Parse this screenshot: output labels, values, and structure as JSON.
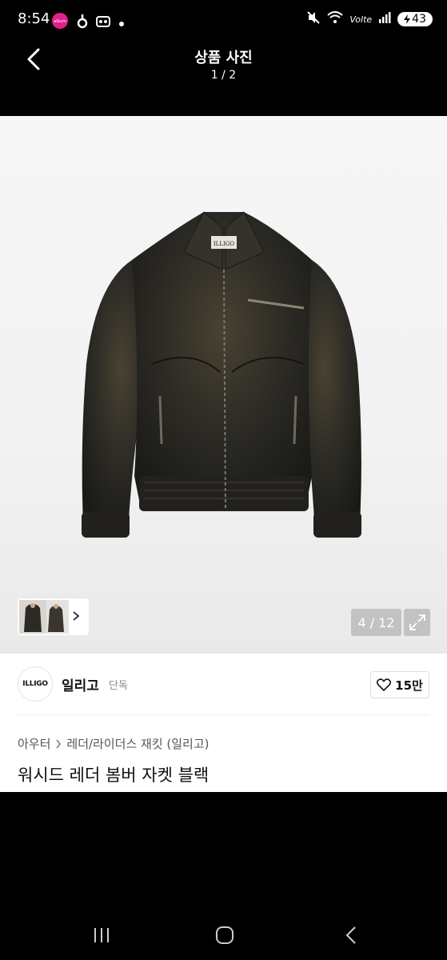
{
  "status_bar": {
    "time": "8:54",
    "lte_label": "Volte",
    "battery": "43"
  },
  "header": {
    "title": "상품 사진",
    "counter": "1 / 2"
  },
  "photo": {
    "jacket_logo": "ILLIGO",
    "page_counter": "4 / 12"
  },
  "brand": {
    "logo_text": "ILLIGO",
    "name": "일리고",
    "badge": "단독",
    "like_count": "15만"
  },
  "breadcrumb": {
    "category": "아우터",
    "subcategory": "레더/라이더스 재킷 (일리고)"
  },
  "product": {
    "title": "워시드 레더 봄버 자켓 블랙"
  },
  "colors": {
    "background": "#000000",
    "photo_bg": "#f2f2f2",
    "jacket": "#2b2a25"
  }
}
